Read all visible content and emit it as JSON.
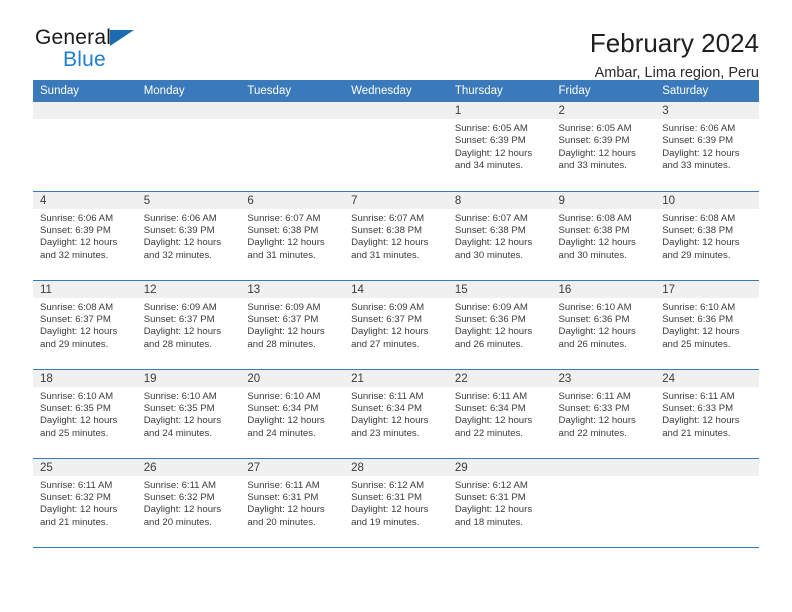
{
  "brand": {
    "line1": "General",
    "line2": "Blue",
    "accent_color": "#1b7fd4",
    "triangle_color": "#1b6cb0"
  },
  "header": {
    "title": "February 2024",
    "subtitle": "Ambar, Lima region, Peru"
  },
  "theme": {
    "header_row_bg": "#3a79ba",
    "daynum_bg": "#f0f0f0",
    "rule_color": "#3a79ba",
    "text_color": "#3c3c3c"
  },
  "weekdays": [
    "Sunday",
    "Monday",
    "Tuesday",
    "Wednesday",
    "Thursday",
    "Friday",
    "Saturday"
  ],
  "weeks": [
    [
      {
        "day": "",
        "blank": true
      },
      {
        "day": "",
        "blank": true
      },
      {
        "day": "",
        "blank": true
      },
      {
        "day": "",
        "blank": true
      },
      {
        "day": "1",
        "sunrise": "Sunrise: 6:05 AM",
        "sunset": "Sunset: 6:39 PM",
        "daylight": "Daylight: 12 hours and 34 minutes."
      },
      {
        "day": "2",
        "sunrise": "Sunrise: 6:05 AM",
        "sunset": "Sunset: 6:39 PM",
        "daylight": "Daylight: 12 hours and 33 minutes."
      },
      {
        "day": "3",
        "sunrise": "Sunrise: 6:06 AM",
        "sunset": "Sunset: 6:39 PM",
        "daylight": "Daylight: 12 hours and 33 minutes."
      }
    ],
    [
      {
        "day": "4",
        "sunrise": "Sunrise: 6:06 AM",
        "sunset": "Sunset: 6:39 PM",
        "daylight": "Daylight: 12 hours and 32 minutes."
      },
      {
        "day": "5",
        "sunrise": "Sunrise: 6:06 AM",
        "sunset": "Sunset: 6:39 PM",
        "daylight": "Daylight: 12 hours and 32 minutes."
      },
      {
        "day": "6",
        "sunrise": "Sunrise: 6:07 AM",
        "sunset": "Sunset: 6:38 PM",
        "daylight": "Daylight: 12 hours and 31 minutes."
      },
      {
        "day": "7",
        "sunrise": "Sunrise: 6:07 AM",
        "sunset": "Sunset: 6:38 PM",
        "daylight": "Daylight: 12 hours and 31 minutes."
      },
      {
        "day": "8",
        "sunrise": "Sunrise: 6:07 AM",
        "sunset": "Sunset: 6:38 PM",
        "daylight": "Daylight: 12 hours and 30 minutes."
      },
      {
        "day": "9",
        "sunrise": "Sunrise: 6:08 AM",
        "sunset": "Sunset: 6:38 PM",
        "daylight": "Daylight: 12 hours and 30 minutes."
      },
      {
        "day": "10",
        "sunrise": "Sunrise: 6:08 AM",
        "sunset": "Sunset: 6:38 PM",
        "daylight": "Daylight: 12 hours and 29 minutes."
      }
    ],
    [
      {
        "day": "11",
        "sunrise": "Sunrise: 6:08 AM",
        "sunset": "Sunset: 6:37 PM",
        "daylight": "Daylight: 12 hours and 29 minutes."
      },
      {
        "day": "12",
        "sunrise": "Sunrise: 6:09 AM",
        "sunset": "Sunset: 6:37 PM",
        "daylight": "Daylight: 12 hours and 28 minutes."
      },
      {
        "day": "13",
        "sunrise": "Sunrise: 6:09 AM",
        "sunset": "Sunset: 6:37 PM",
        "daylight": "Daylight: 12 hours and 28 minutes."
      },
      {
        "day": "14",
        "sunrise": "Sunrise: 6:09 AM",
        "sunset": "Sunset: 6:37 PM",
        "daylight": "Daylight: 12 hours and 27 minutes."
      },
      {
        "day": "15",
        "sunrise": "Sunrise: 6:09 AM",
        "sunset": "Sunset: 6:36 PM",
        "daylight": "Daylight: 12 hours and 26 minutes."
      },
      {
        "day": "16",
        "sunrise": "Sunrise: 6:10 AM",
        "sunset": "Sunset: 6:36 PM",
        "daylight": "Daylight: 12 hours and 26 minutes."
      },
      {
        "day": "17",
        "sunrise": "Sunrise: 6:10 AM",
        "sunset": "Sunset: 6:36 PM",
        "daylight": "Daylight: 12 hours and 25 minutes."
      }
    ],
    [
      {
        "day": "18",
        "sunrise": "Sunrise: 6:10 AM",
        "sunset": "Sunset: 6:35 PM",
        "daylight": "Daylight: 12 hours and 25 minutes."
      },
      {
        "day": "19",
        "sunrise": "Sunrise: 6:10 AM",
        "sunset": "Sunset: 6:35 PM",
        "daylight": "Daylight: 12 hours and 24 minutes."
      },
      {
        "day": "20",
        "sunrise": "Sunrise: 6:10 AM",
        "sunset": "Sunset: 6:34 PM",
        "daylight": "Daylight: 12 hours and 24 minutes."
      },
      {
        "day": "21",
        "sunrise": "Sunrise: 6:11 AM",
        "sunset": "Sunset: 6:34 PM",
        "daylight": "Daylight: 12 hours and 23 minutes."
      },
      {
        "day": "22",
        "sunrise": "Sunrise: 6:11 AM",
        "sunset": "Sunset: 6:34 PM",
        "daylight": "Daylight: 12 hours and 22 minutes."
      },
      {
        "day": "23",
        "sunrise": "Sunrise: 6:11 AM",
        "sunset": "Sunset: 6:33 PM",
        "daylight": "Daylight: 12 hours and 22 minutes."
      },
      {
        "day": "24",
        "sunrise": "Sunrise: 6:11 AM",
        "sunset": "Sunset: 6:33 PM",
        "daylight": "Daylight: 12 hours and 21 minutes."
      }
    ],
    [
      {
        "day": "25",
        "sunrise": "Sunrise: 6:11 AM",
        "sunset": "Sunset: 6:32 PM",
        "daylight": "Daylight: 12 hours and 21 minutes."
      },
      {
        "day": "26",
        "sunrise": "Sunrise: 6:11 AM",
        "sunset": "Sunset: 6:32 PM",
        "daylight": "Daylight: 12 hours and 20 minutes."
      },
      {
        "day": "27",
        "sunrise": "Sunrise: 6:11 AM",
        "sunset": "Sunset: 6:31 PM",
        "daylight": "Daylight: 12 hours and 20 minutes."
      },
      {
        "day": "28",
        "sunrise": "Sunrise: 6:12 AM",
        "sunset": "Sunset: 6:31 PM",
        "daylight": "Daylight: 12 hours and 19 minutes."
      },
      {
        "day": "29",
        "sunrise": "Sunrise: 6:12 AM",
        "sunset": "Sunset: 6:31 PM",
        "daylight": "Daylight: 12 hours and 18 minutes."
      },
      {
        "day": "",
        "blank": true
      },
      {
        "day": "",
        "blank": true
      }
    ]
  ]
}
